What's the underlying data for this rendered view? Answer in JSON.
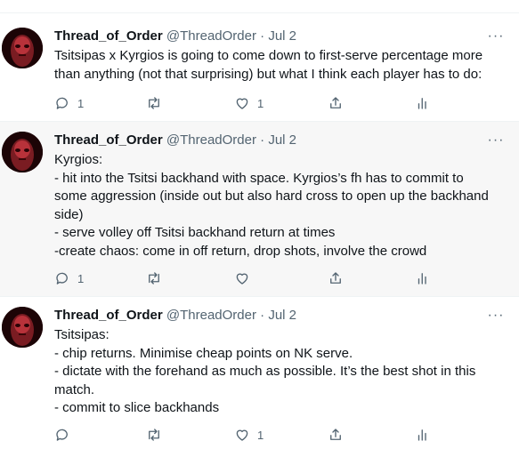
{
  "tweets": [
    {
      "name": "Thread_of_Order",
      "handle": "@ThreadOrder",
      "separator": "·",
      "date": "Jul 2",
      "more": "···",
      "lines": [
        "Tsitsipas x Kyrgios is going to come down to first-serve percentage more",
        "than anything (not that surprising) but what I think each player has to do:"
      ],
      "replies": "1",
      "retweets": "",
      "likes": "1"
    },
    {
      "name": "Thread_of_Order",
      "handle": "@ThreadOrder",
      "separator": "·",
      "date": "Jul 2",
      "more": "···",
      "lines": [
        "Kyrgios:",
        "- hit into the Tsitsi backhand with space. Kyrgios’s fh has to commit to",
        "some aggression (inside out but also hard cross to open up the backhand",
        "side)",
        "- serve volley off Tsitsi backhand return at times",
        "-create chaos: come in off return, drop shots, involve the crowd"
      ],
      "replies": "1",
      "retweets": "",
      "likes": ""
    },
    {
      "name": "Thread_of_Order",
      "handle": "@ThreadOrder",
      "separator": "·",
      "date": "Jul 2",
      "more": "···",
      "lines": [
        "Tsitsipas:",
        "- chip returns. Minimise cheap points on NK serve.",
        "- dictate with the forehand as much as possible. It’s the best shot in this",
        "match.",
        "- commit to slice backhands"
      ],
      "replies": "",
      "retweets": "",
      "likes": "1"
    }
  ],
  "icons": {
    "reply": "reply-icon",
    "retweet": "retweet-icon",
    "like": "heart-icon",
    "share": "share-icon",
    "analytics": "analytics-icon",
    "more": "more-icon"
  },
  "colors": {
    "text": "#0f1419",
    "muted": "#536471",
    "highlight_bg": "#f7f7f7",
    "thread_line": "#cfd9de",
    "avatar_bg": "#200507"
  }
}
